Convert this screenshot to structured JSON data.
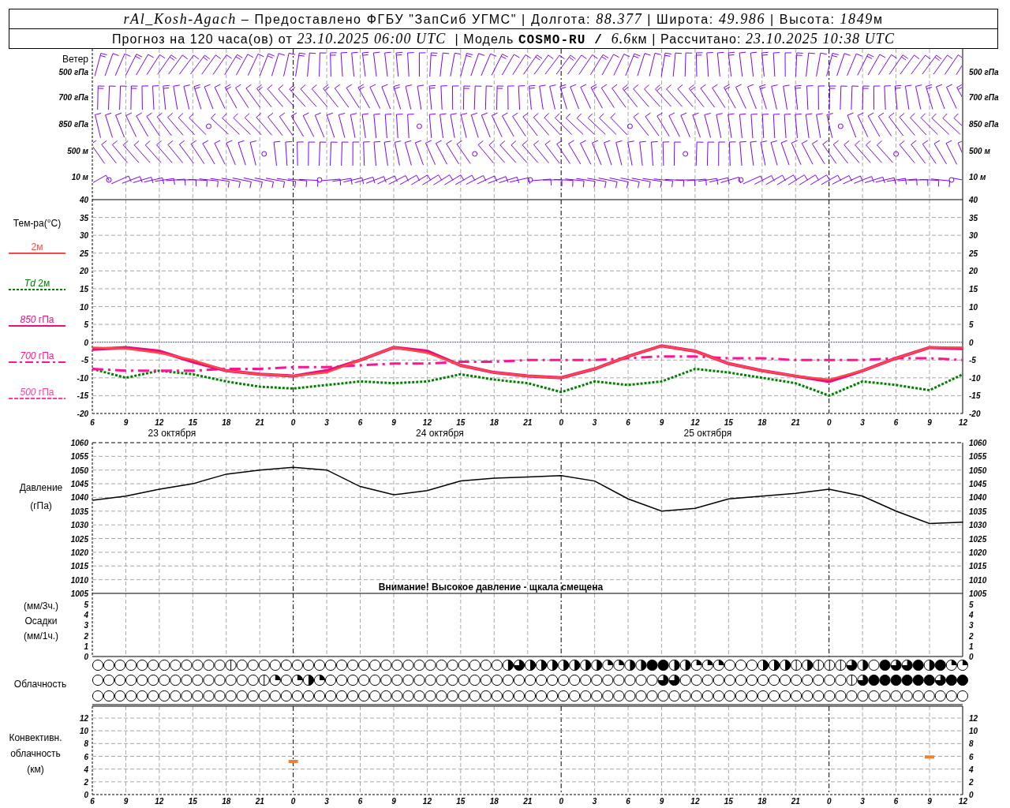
{
  "header": {
    "title": [
      {
        "kind": "italic",
        "text": "rAl_Kosh-Agach"
      },
      {
        "kind": "plain",
        "text": " – Предоставлено ФГБУ \"ЗапСиб УГМС\" | Долгота: "
      },
      {
        "kind": "italic",
        "text": "88.377"
      },
      {
        "kind": "plain",
        "text": " | Широта: "
      },
      {
        "kind": "italic",
        "text": "49.986"
      },
      {
        "kind": "plain",
        "text": " | Высота: "
      },
      {
        "kind": "italic",
        "text": "1849"
      },
      {
        "kind": "plain",
        "text": "м"
      }
    ],
    "forecast": [
      {
        "kind": "plain",
        "text": "Прогноз на 120 часа(ов) от "
      },
      {
        "kind": "italic",
        "text": "23.10.2025 06:00 UTC"
      },
      {
        "kind": "plain",
        "text": "  | Модель "
      },
      {
        "kind": "bold",
        "text": "COSMO-RU / "
      },
      {
        "kind": "italic",
        "text": "6.6"
      },
      {
        "kind": "plain",
        "text": "км | Рассчитано: "
      },
      {
        "kind": "italic",
        "text": "23.10.2025 10:38 UTC"
      }
    ]
  },
  "wind": {
    "title": "Ветер",
    "levels": [
      {
        "label": "*500* гПа",
        "right_label": "*500* гПа"
      },
      {
        "label": "*700* гПа",
        "right_label": "*700* гПа"
      },
      {
        "label": "*850* гПа",
        "right_label": "*850* гПа"
      },
      {
        "label": "*500* м",
        "right_label": "*500* м"
      },
      {
        "label": "*10*   м",
        "right_label": "*10* м"
      }
    ]
  },
  "temperature": {
    "title": "Тем-ра(°С)",
    "right_ticks": [
      "40",
      "35",
      "30",
      "25",
      "20",
      "15",
      "10",
      "5",
      "0",
      "-5",
      "-10",
      "-15",
      "-20"
    ],
    "dates": [
      "23 октября",
      "24 октября",
      "25 октября"
    ],
    "chart_data": {
      "type": "line",
      "ylim": [
        -20,
        40
      ],
      "yticks": [
        40,
        35,
        30,
        25,
        20,
        15,
        10,
        5,
        0,
        -5,
        -10,
        -15,
        -20
      ],
      "categories": [
        "6",
        "9",
        "12",
        "15",
        "18",
        "21",
        "0",
        "3",
        "6",
        "9",
        "12",
        "15",
        "18",
        "21",
        "0",
        "3",
        "6",
        "9",
        "12",
        "15",
        "18",
        "21",
        "0",
        "3",
        "6",
        "9",
        "12"
      ],
      "series": [
        {
          "name": "2м",
          "color": "#ff4848",
          "line_style": "solid",
          "values": [
            -1.5,
            -1.8,
            -3,
            -5,
            -8,
            -9,
            -9.5,
            -8.5,
            -5,
            -1.5,
            -3,
            -6.5,
            -8.5,
            -9.5,
            -10,
            -7.5,
            -4,
            -1,
            -2.5,
            -6,
            -8,
            -9.5,
            -10.5,
            -8,
            -4.5,
            -1.5,
            -1.5
          ]
        },
        {
          "name": "*Td*  2м",
          "color": "#008000",
          "line_style": "dotted",
          "values": [
            -7.5,
            -10,
            -8,
            -9,
            -11,
            -12.5,
            -13,
            -12,
            -11,
            -11.5,
            -11,
            -9,
            -10.5,
            -11.5,
            -14,
            -11,
            -12,
            -11,
            -7.5,
            -8.5,
            -10,
            -11.5,
            -15,
            -11,
            -12,
            -13.5,
            -9
          ]
        },
        {
          "name": "*850* гПа",
          "color": "#e8107c",
          "line_style": "solid",
          "values": [
            -2,
            -1.5,
            -2.5,
            -5.5,
            -8,
            -9,
            -9.5,
            -8,
            -5,
            -1.5,
            -2.5,
            -6.5,
            -8.5,
            -9.5,
            -10,
            -7.5,
            -4,
            -1,
            -2.5,
            -6,
            -8,
            -9.5,
            -11,
            -8,
            -4.5,
            -1.5,
            -1.8
          ]
        },
        {
          "name": "*700* гПа",
          "color": "#ff1493",
          "line_style": "dashdot",
          "values": [
            -7.5,
            -8,
            -8,
            -8,
            -7.5,
            -7.5,
            -7,
            -7,
            -6.5,
            -6,
            -6,
            -5.5,
            -5.5,
            -5,
            -5,
            -5,
            -4.5,
            -4,
            -4,
            -4.5,
            -4.5,
            -5,
            -5,
            -5,
            -4.5,
            -4.5,
            -5
          ]
        },
        {
          "name": "*500* гПа",
          "color": "#ff3ca0",
          "line_style": "dashed",
          "values": [
            null,
            null,
            null,
            null,
            null,
            null,
            null,
            null,
            null,
            null,
            null,
            null,
            null,
            null,
            null,
            null,
            null,
            null,
            null,
            null,
            null,
            null,
            null,
            null,
            null,
            null,
            null
          ]
        }
      ]
    }
  },
  "pressure": {
    "title": "Давление",
    "unit": "(гПа)",
    "right_ticks": [
      "1060",
      "1055",
      "1050",
      "1045",
      "1040",
      "1035",
      "1030",
      "1025",
      "1020",
      "1015",
      "1010",
      "1005"
    ],
    "warning": "Внимание! Высокое давление - щкала смещена",
    "chart_data": {
      "type": "line",
      "ylim": [
        1005,
        1060
      ],
      "yticks": [
        1060,
        1055,
        1050,
        1045,
        1040,
        1035,
        1030,
        1025,
        1020,
        1015,
        1010,
        1005
      ],
      "series": [
        {
          "color": "#000000",
          "values": [
            1039,
            1040.5,
            1043,
            1045,
            1048.5,
            1050,
            1051,
            1050,
            1044,
            1041,
            1042.5,
            1046,
            1047,
            1047.5,
            1048,
            1046,
            1039.5,
            1035,
            1036,
            1039.5,
            1040.5,
            1041.5,
            1043,
            1040.5,
            1035,
            1030.5,
            1031
          ]
        }
      ]
    }
  },
  "precipitation": {
    "labels": [
      "(мм/3ч.)",
      "Осадки",
      "(мм/1ч.)"
    ],
    "left_ticks": [
      "5",
      "4",
      "3",
      "2",
      "1",
      "0"
    ],
    "right_ticks": [
      "5",
      "4",
      "3",
      "2",
      "1",
      "0"
    ]
  },
  "cloud_cover": {
    "title": "Облачность",
    "rows": [
      {
        "cells": [
          {
            "kind": "clear"
          },
          {
            "kind": "clear"
          },
          {
            "kind": "clear"
          },
          {
            "kind": "clear"
          },
          {
            "kind": "clear"
          },
          {
            "kind": "clear"
          },
          {
            "kind": "clear"
          },
          {
            "kind": "clear"
          },
          {
            "kind": "clear"
          },
          {
            "kind": "clear"
          },
          {
            "kind": "clear"
          },
          {
            "kind": "clear"
          },
          {
            "kind": "trace"
          },
          {
            "kind": "clear"
          },
          {
            "kind": "clear"
          },
          {
            "kind": "clear"
          },
          {
            "kind": "clear"
          },
          {
            "kind": "clear"
          },
          {
            "kind": "clear"
          },
          {
            "kind": "clear"
          },
          {
            "kind": "clear"
          },
          {
            "kind": "clear"
          },
          {
            "kind": "clear"
          },
          {
            "kind": "clear"
          },
          {
            "kind": "clear"
          },
          {
            "kind": "clear"
          },
          {
            "kind": "clear"
          },
          {
            "kind": "clear"
          },
          {
            "kind": "clear"
          },
          {
            "kind": "clear"
          },
          {
            "kind": "clear"
          },
          {
            "kind": "clear"
          },
          {
            "kind": "clear"
          },
          {
            "kind": "clear"
          },
          {
            "kind": "clear"
          },
          {
            "kind": "clear"
          },
          {
            "kind": "clear"
          },
          {
            "kind": "half"
          },
          {
            "kind": "three_quarters"
          },
          {
            "kind": "half"
          },
          {
            "kind": "half"
          },
          {
            "kind": "half"
          },
          {
            "kind": "half"
          },
          {
            "kind": "half"
          },
          {
            "kind": "half"
          },
          {
            "kind": "half"
          },
          {
            "kind": "quarter"
          },
          {
            "kind": "quarter"
          },
          {
            "kind": "half"
          },
          {
            "kind": "half"
          },
          {
            "kind": "overcast"
          },
          {
            "kind": "overcast"
          },
          {
            "kind": "half"
          },
          {
            "kind": "half"
          },
          {
            "kind": "quarter"
          },
          {
            "kind": "quarter"
          },
          {
            "kind": "quarter"
          },
          {
            "kind": "clear"
          },
          {
            "kind": "clear"
          },
          {
            "kind": "clear"
          },
          {
            "kind": "half"
          },
          {
            "kind": "half"
          },
          {
            "kind": "half"
          },
          {
            "kind": "trace"
          },
          {
            "kind": "half"
          },
          {
            "kind": "trace"
          },
          {
            "kind": "trace"
          },
          {
            "kind": "trace"
          },
          {
            "kind": "three_quarters"
          },
          {
            "kind": "half"
          },
          {
            "kind": "clear"
          },
          {
            "kind": "overcast"
          },
          {
            "kind": "three_quarters"
          },
          {
            "kind": "three_quarters"
          },
          {
            "kind": "overcast"
          },
          {
            "kind": "half"
          },
          {
            "kind": "overcast"
          },
          {
            "kind": "quarter"
          },
          {
            "kind": "quarter"
          }
        ]
      },
      {
        "cells": [
          {
            "kind": "clear"
          },
          {
            "kind": "clear"
          },
          {
            "kind": "clear"
          },
          {
            "kind": "clear"
          },
          {
            "kind": "clear"
          },
          {
            "kind": "clear"
          },
          {
            "kind": "clear"
          },
          {
            "kind": "clear"
          },
          {
            "kind": "clear"
          },
          {
            "kind": "clear"
          },
          {
            "kind": "clear"
          },
          {
            "kind": "clear"
          },
          {
            "kind": "clear"
          },
          {
            "kind": "clear"
          },
          {
            "kind": "clear"
          },
          {
            "kind": "trace"
          },
          {
            "kind": "quarter"
          },
          {
            "kind": "clear"
          },
          {
            "kind": "quarter"
          },
          {
            "kind": "half"
          },
          {
            "kind": "quarter"
          },
          {
            "kind": "clear"
          },
          {
            "kind": "clear"
          },
          {
            "kind": "clear"
          },
          {
            "kind": "clear"
          },
          {
            "kind": "clear"
          },
          {
            "kind": "clear"
          },
          {
            "kind": "clear"
          },
          {
            "kind": "clear"
          },
          {
            "kind": "clear"
          },
          {
            "kind": "clear"
          },
          {
            "kind": "clear"
          },
          {
            "kind": "clear"
          },
          {
            "kind": "clear"
          },
          {
            "kind": "clear"
          },
          {
            "kind": "clear"
          },
          {
            "kind": "clear"
          },
          {
            "kind": "clear"
          },
          {
            "kind": "clear"
          },
          {
            "kind": "clear"
          },
          {
            "kind": "clear"
          },
          {
            "kind": "clear"
          },
          {
            "kind": "clear"
          },
          {
            "kind": "clear"
          },
          {
            "kind": "clear"
          },
          {
            "kind": "clear"
          },
          {
            "kind": "clear"
          },
          {
            "kind": "clear"
          },
          {
            "kind": "clear"
          },
          {
            "kind": "clear"
          },
          {
            "kind": "clear"
          },
          {
            "kind": "three_quarters"
          },
          {
            "kind": "three_quarters"
          },
          {
            "kind": "clear"
          },
          {
            "kind": "clear"
          },
          {
            "kind": "clear"
          },
          {
            "kind": "clear"
          },
          {
            "kind": "clear"
          },
          {
            "kind": "clear"
          },
          {
            "kind": "clear"
          },
          {
            "kind": "clear"
          },
          {
            "kind": "clear"
          },
          {
            "kind": "clear"
          },
          {
            "kind": "clear"
          },
          {
            "kind": "clear"
          },
          {
            "kind": "clear"
          },
          {
            "kind": "clear"
          },
          {
            "kind": "clear"
          },
          {
            "kind": "trace"
          },
          {
            "kind": "three_quarters"
          },
          {
            "kind": "overcast"
          },
          {
            "kind": "overcast"
          },
          {
            "kind": "overcast"
          },
          {
            "kind": "overcast"
          },
          {
            "kind": "overcast"
          },
          {
            "kind": "overcast"
          },
          {
            "kind": "three_quarters"
          },
          {
            "kind": "overcast"
          },
          {
            "kind": "overcast"
          }
        ]
      },
      {
        "cells": [
          {
            "kind": "clear"
          },
          {
            "kind": "clear"
          },
          {
            "kind": "clear"
          },
          {
            "kind": "clear"
          },
          {
            "kind": "clear"
          },
          {
            "kind": "clear"
          },
          {
            "kind": "clear"
          },
          {
            "kind": "clear"
          },
          {
            "kind": "clear"
          },
          {
            "kind": "clear"
          },
          {
            "kind": "clear"
          },
          {
            "kind": "clear"
          },
          {
            "kind": "clear"
          },
          {
            "kind": "clear"
          },
          {
            "kind": "clear"
          },
          {
            "kind": "clear"
          },
          {
            "kind": "clear"
          },
          {
            "kind": "clear"
          },
          {
            "kind": "clear"
          },
          {
            "kind": "clear"
          },
          {
            "kind": "clear"
          },
          {
            "kind": "clear"
          },
          {
            "kind": "clear"
          },
          {
            "kind": "clear"
          },
          {
            "kind": "clear"
          },
          {
            "kind": "clear"
          },
          {
            "kind": "clear"
          },
          {
            "kind": "clear"
          },
          {
            "kind": "clear"
          },
          {
            "kind": "clear"
          },
          {
            "kind": "clear"
          },
          {
            "kind": "clear"
          },
          {
            "kind": "clear"
          },
          {
            "kind": "clear"
          },
          {
            "kind": "clear"
          },
          {
            "kind": "clear"
          },
          {
            "kind": "clear"
          },
          {
            "kind": "clear"
          },
          {
            "kind": "clear"
          },
          {
            "kind": "clear"
          },
          {
            "kind": "clear"
          },
          {
            "kind": "clear"
          },
          {
            "kind": "clear"
          },
          {
            "kind": "clear"
          },
          {
            "kind": "clear"
          },
          {
            "kind": "clear"
          },
          {
            "kind": "clear"
          },
          {
            "kind": "clear"
          },
          {
            "kind": "clear"
          },
          {
            "kind": "clear"
          },
          {
            "kind": "clear"
          },
          {
            "kind": "clear"
          },
          {
            "kind": "clear"
          },
          {
            "kind": "clear"
          },
          {
            "kind": "clear"
          },
          {
            "kind": "clear"
          },
          {
            "kind": "clear"
          },
          {
            "kind": "clear"
          },
          {
            "kind": "clear"
          },
          {
            "kind": "clear"
          },
          {
            "kind": "clear"
          },
          {
            "kind": "clear"
          },
          {
            "kind": "clear"
          },
          {
            "kind": "clear"
          },
          {
            "kind": "clear"
          },
          {
            "kind": "clear"
          },
          {
            "kind": "clear"
          },
          {
            "kind": "clear"
          },
          {
            "kind": "clear"
          },
          {
            "kind": "clear"
          },
          {
            "kind": "clear"
          },
          {
            "kind": "clear"
          },
          {
            "kind": "clear"
          },
          {
            "kind": "clear"
          },
          {
            "kind": "clear"
          },
          {
            "kind": "clear"
          },
          {
            "kind": "clear"
          },
          {
            "kind": "clear"
          },
          {
            "kind": "clear"
          }
        ]
      }
    ]
  },
  "convective": {
    "labels": [
      "Конвективн.",
      "облачность",
      "(км)"
    ],
    "right_ticks": [
      "12",
      "10",
      "8",
      "6",
      "4",
      "2",
      "0"
    ],
    "chart_data": {
      "type": "scatter",
      "ylim": [
        0,
        12
      ],
      "yticks": [
        12,
        10,
        8,
        6,
        4,
        2,
        0
      ],
      "categories": [
        "6",
        "9",
        "12",
        "15",
        "18",
        "21",
        "0",
        "3",
        "6",
        "9",
        "12",
        "15",
        "18",
        "21",
        "0",
        "3",
        "6",
        "9",
        "12",
        "15",
        "18",
        "21",
        "0",
        "3",
        "6",
        "9",
        "12"
      ],
      "series": [
        {
          "color": "#f08030",
          "values": [
            null,
            null,
            null,
            null,
            null,
            null,
            5.2,
            null,
            null,
            null,
            null,
            null,
            null,
            null,
            null,
            null,
            null,
            null,
            null,
            null,
            null,
            null,
            null,
            null,
            null,
            5.9,
            null
          ]
        }
      ]
    }
  }
}
